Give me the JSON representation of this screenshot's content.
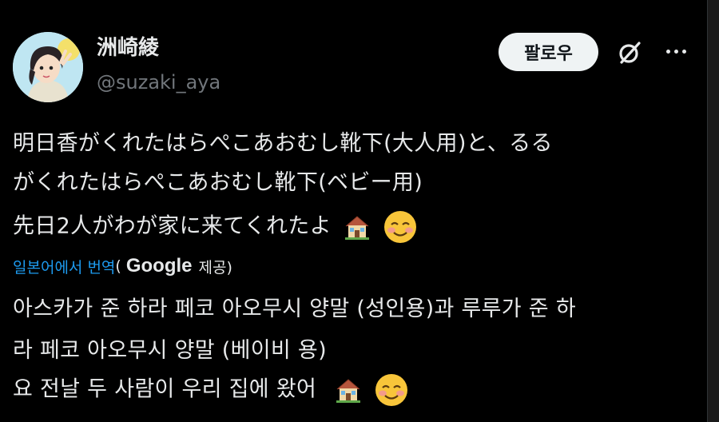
{
  "author": {
    "display_name": "洲崎綾",
    "handle": "@suzaki_aya"
  },
  "actions": {
    "follow_label": "팔로우",
    "grok_icon": "grok-slash-icon",
    "more_icon": "more-horizontal-icon"
  },
  "post": {
    "lines": [
      "明日香がくれたはらぺこあおむし靴下(大人用)と、るる",
      "がくれたはらぺこあおむし靴下(ベビー用)",
      "先日2人がわが家に来てくれたよ"
    ],
    "emojis": [
      "house-emoji",
      "smiling-blush-emoji"
    ]
  },
  "translation": {
    "link_label": "일본어에서 번역",
    "open_paren": "(",
    "provider": "Google",
    "provided_label": "제공)",
    "lines": [
      "아스카가 준 하라 페코 아오무시 양말 (성인용)과 루루가 준 하",
      "라 페코 아오무시 양말 (베이비 용)",
      "요 전날 두 사람이 우리 집에 왔어"
    ]
  }
}
